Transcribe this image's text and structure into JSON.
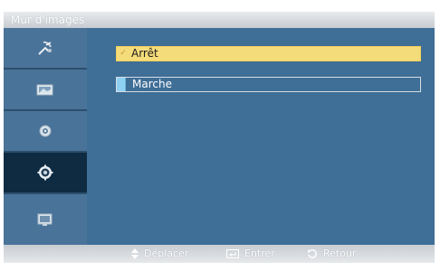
{
  "window": {
    "title": "Mur d'images"
  },
  "sidebar": {
    "items": [
      {
        "icon": "antenna-icon",
        "active": false
      },
      {
        "icon": "picture-icon",
        "active": false
      },
      {
        "icon": "sound-icon",
        "active": false
      },
      {
        "icon": "setup-icon",
        "active": true
      },
      {
        "icon": "multi-screen-icon",
        "active": false
      }
    ]
  },
  "options": [
    {
      "label": "Arrêt",
      "selected": true,
      "mark": "✓"
    },
    {
      "label": "Marche",
      "selected": false,
      "mark": ""
    }
  ],
  "footer": {
    "move_label": "Déplacer",
    "enter_label": "Entrer",
    "return_label": "Retour"
  },
  "colors": {
    "frame": "#3f6e96",
    "sidebar": "#4a7399",
    "active_item": "#0f2b42",
    "selected_option": "#f5dc7a"
  }
}
